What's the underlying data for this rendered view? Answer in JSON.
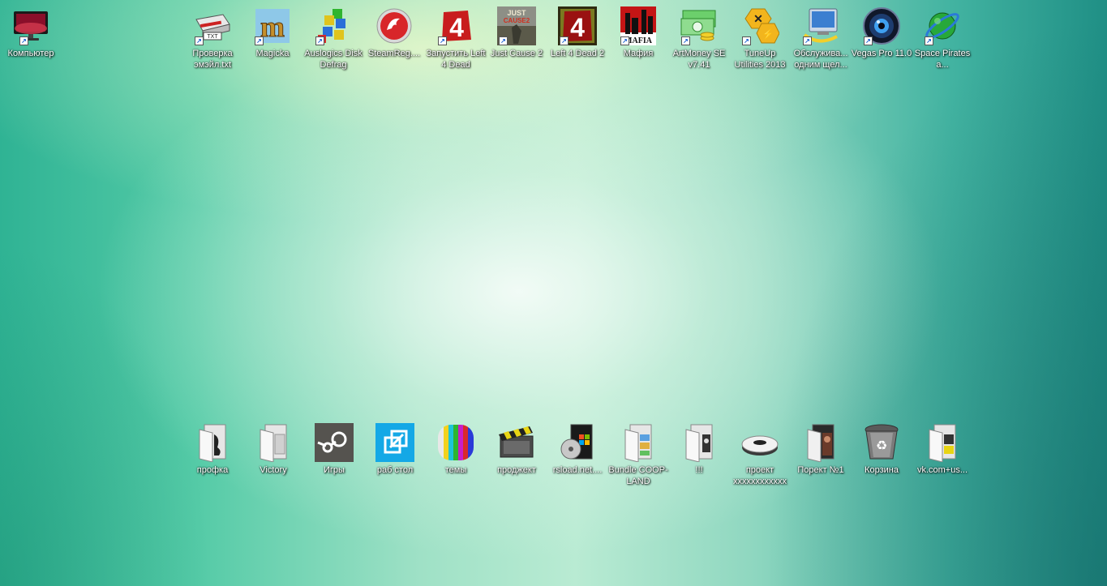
{
  "desktop": {
    "top_icons": [
      {
        "label": "Компьютер",
        "icon": "computer-monitor-icon",
        "shortcut": true,
        "color": "#b0173a"
      },
      {
        "label": "Проверка эмэйл.txt",
        "icon": "txt-file-icon",
        "shortcut": true,
        "color": "#333333"
      },
      {
        "label": "Magicka",
        "icon": "magicka-icon",
        "shortcut": true,
        "color": "#b58a2a"
      },
      {
        "label": "Auslogics Disk Defrag",
        "icon": "defrag-icon",
        "shortcut": true,
        "color": "#2a6fd8"
      },
      {
        "label": "SteamReg....",
        "icon": "steamreg-icon",
        "shortcut": false,
        "color": "#d8262a"
      },
      {
        "label": "Запустить Left 4 Dead",
        "icon": "left4dead-icon",
        "shortcut": true,
        "color": "#c81d1d"
      },
      {
        "label": "Just Cause 2",
        "icon": "justcause-icon",
        "shortcut": true,
        "color": "#6a6a5a"
      },
      {
        "label": "Left 4 Dead 2",
        "icon": "left4dead2-icon",
        "shortcut": true,
        "color": "#8a1010"
      },
      {
        "label": "Мафия",
        "icon": "mafia-icon",
        "shortcut": true,
        "color": "#b01010"
      },
      {
        "label": "ArtMoney SE v7.41",
        "icon": "artmoney-icon",
        "shortcut": true,
        "color": "#3fa83f"
      },
      {
        "label": "TuneUp Utilities 2013",
        "icon": "tuneup-icon",
        "shortcut": true,
        "color": "#f2b51d"
      },
      {
        "label": "Обслужива... одним щел...",
        "icon": "maintenance-icon",
        "shortcut": true,
        "color": "#3b7fd0"
      },
      {
        "label": "Vegas Pro 11.0",
        "icon": "vegas-icon",
        "shortcut": true,
        "color": "#1d3c6e"
      },
      {
        "label": "Space Pirates a...",
        "icon": "space-pirates-icon",
        "shortcut": true,
        "color": "#27a83a"
      }
    ],
    "bottom_icons": [
      {
        "label": "профка",
        "icon": "folder-icon",
        "shortcut": false,
        "color": "#dddddd"
      },
      {
        "label": "Victory",
        "icon": "folder-icon",
        "shortcut": false,
        "color": "#dddddd"
      },
      {
        "label": "Игры",
        "icon": "steam-games-icon",
        "shortcut": false,
        "color": "#55534f"
      },
      {
        "label": "раб стол",
        "icon": "desktop-shortcut-icon",
        "shortcut": false,
        "color": "#14a8e6"
      },
      {
        "label": "темы",
        "icon": "themes-icon",
        "shortcut": false,
        "color": "#7a1fd0"
      },
      {
        "label": "проджект",
        "icon": "clapperboard-icon",
        "shortcut": false,
        "color": "#d8c414"
      },
      {
        "label": "rsload.net....",
        "icon": "windows-dvd-icon",
        "shortcut": false,
        "color": "#222222"
      },
      {
        "label": "Bundle COOP-LAND",
        "icon": "folder-icon",
        "shortcut": false,
        "color": "#dddddd"
      },
      {
        "label": "!!!",
        "icon": "folder-icon",
        "shortcut": false,
        "color": "#dddddd"
      },
      {
        "label": "проект xxxxxxxxxxxx",
        "icon": "device-icon",
        "shortcut": false,
        "color": "#444444"
      },
      {
        "label": "Порект №1",
        "icon": "folder-dark-icon",
        "shortcut": false,
        "color": "#222222"
      },
      {
        "label": "Корзина",
        "icon": "recycle-bin-icon",
        "shortcut": false,
        "color": "#707070"
      },
      {
        "label": "vk.com+us...",
        "icon": "folder-icon",
        "shortcut": false,
        "color": "#dddddd"
      }
    ]
  }
}
